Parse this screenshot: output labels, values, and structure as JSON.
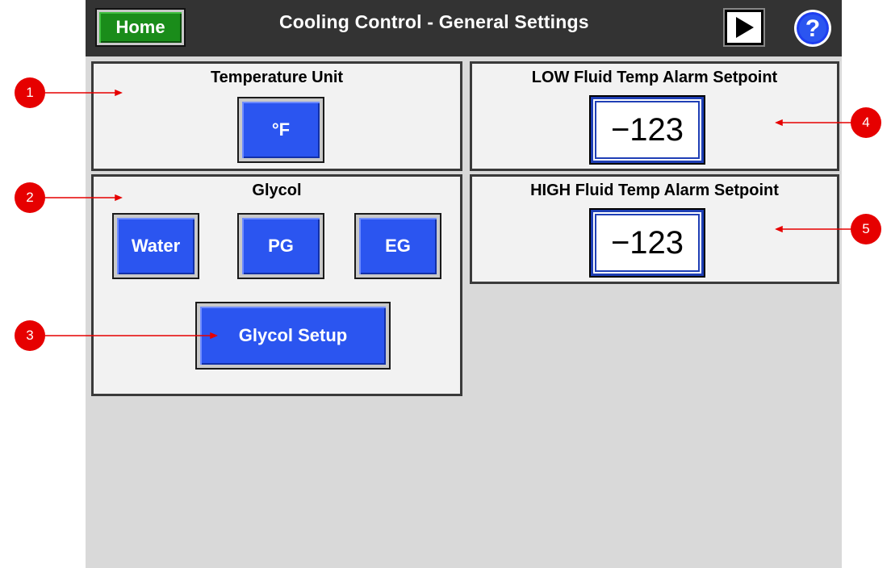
{
  "header": {
    "home_label": "Home",
    "title": "Cooling Control - General Settings",
    "help_symbol": "?"
  },
  "temperature_unit": {
    "title": "Temperature Unit",
    "button_label": "°F"
  },
  "glycol": {
    "title": "Glycol",
    "options": [
      "Water",
      "PG",
      "EG"
    ],
    "setup_label": "Glycol Setup"
  },
  "low_alarm": {
    "title": "LOW Fluid Temp Alarm Setpoint",
    "value": "−123"
  },
  "high_alarm": {
    "title": "HIGH Fluid Temp Alarm Setpoint",
    "value": "−123"
  },
  "callouts": [
    "1",
    "2",
    "3",
    "4",
    "5"
  ],
  "colors": {
    "accent_blue": "#2b55f0",
    "home_green": "#1a8c1a",
    "callout_red": "#e60000",
    "titlebar": "#333333"
  }
}
